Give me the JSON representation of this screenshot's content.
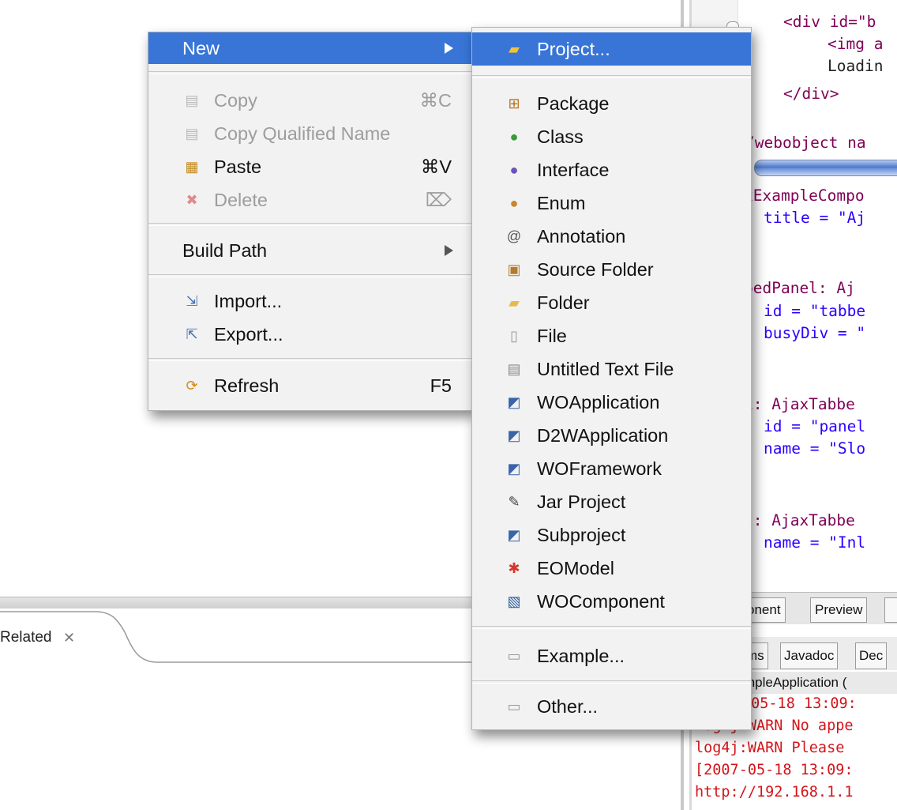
{
  "context_menu": {
    "new_label": "New",
    "copy_label": "Copy",
    "copy_shortcut": "⌘C",
    "copy_qualified_label": "Copy Qualified Name",
    "paste_label": "Paste",
    "paste_shortcut": "⌘V",
    "delete_label": "Delete",
    "delete_shortcut": "⌦",
    "build_path_label": "Build Path",
    "import_label": "Import...",
    "export_label": "Export...",
    "refresh_label": "Refresh",
    "refresh_shortcut": "F5"
  },
  "submenu": {
    "items": [
      "Project...",
      "Package",
      "Class",
      "Interface",
      "Enum",
      "Annotation",
      "Source Folder",
      "Folder",
      "File",
      "Untitled Text File",
      "WOApplication",
      "D2WApplication",
      "WOFramework",
      "Jar Project",
      "Subproject",
      "EOModel",
      "WOComponent",
      "Example...",
      "Other..."
    ]
  },
  "editor": {
    "lines": [
      "<div id=\"b",
      "<img a",
      "Loadin",
      "</div>",
      "/webobject na",
      "xExampleCompo",
      "title = \"Aj",
      "bedPanel: Aj",
      "id = \"tabbe",
      "busyDiv = \"",
      "1: AjaxTabbe",
      "id = \"panel",
      "name = \"Slo",
      "2: AjaxTabbe",
      "name = \"Inl"
    ],
    "tabs": [
      "onent",
      "Preview"
    ]
  },
  "console": {
    "tabs": [
      "ms",
      "Javadoc",
      "Dec"
    ],
    "title": "mpleApplication (",
    "lines": [
      "-05-18 13:09:",
      "log4j:WARN No appe",
      "log4j:WARN Please",
      "[2007-05-18 13:09:",
      "http://192.168.1.1"
    ]
  },
  "related_view": {
    "tab_label": "Related"
  },
  "colors": {
    "highlight": "#3875d7",
    "menu_bg": "#f2f2f2",
    "console_text": "#d4141a"
  }
}
